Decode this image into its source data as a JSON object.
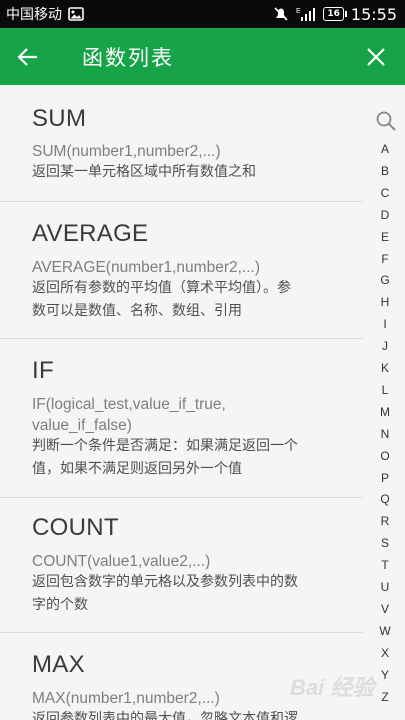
{
  "status_bar": {
    "carrier": "中国移动",
    "signal_label": "E",
    "battery": "16",
    "time": "15:55"
  },
  "app_bar": {
    "title": "函数列表"
  },
  "functions": [
    {
      "name": "SUM",
      "syntax": "SUM(number1,number2,...)",
      "desc_lines": [
        "返回某一单元格区域中所有数值之和"
      ]
    },
    {
      "name": "AVERAGE",
      "syntax": "AVERAGE(number1,number2,...)",
      "desc_lines": [
        "返回所有参数的平均值（算术平均值）。参",
        "数可以是数值、名称、数组、引用"
      ]
    },
    {
      "name": "IF",
      "syntax_lines": [
        "IF(logical_test,value_if_true,",
        "value_if_false)"
      ],
      "desc_lines": [
        "判断一个条件是否满足：如果满足返回一个",
        "值，如果不满足则返回另外一个值"
      ]
    },
    {
      "name": "COUNT",
      "syntax": "COUNT(value1,value2,...)",
      "desc_lines": [
        "返回包含数字的单元格以及参数列表中的数",
        "字的个数"
      ]
    },
    {
      "name": "MAX",
      "syntax": "MAX(number1,number2,...)",
      "desc_lines": [
        "返回参数列表中的最大值，忽略文本值和逻"
      ]
    }
  ],
  "index_letters": [
    "A",
    "B",
    "C",
    "D",
    "E",
    "F",
    "G",
    "H",
    "I",
    "J",
    "K",
    "L",
    "M",
    "N",
    "O",
    "P",
    "Q",
    "R",
    "S",
    "T",
    "U",
    "V",
    "W",
    "X",
    "Y",
    "Z"
  ],
  "watermark": "Bai 经验",
  "icons": {
    "back": "arrow-left-icon",
    "close": "close-icon",
    "search": "search-icon"
  },
  "colors": {
    "app_bar": "#17a348",
    "status_bar": "#0a0a0a",
    "background": "#f5f5f5"
  }
}
